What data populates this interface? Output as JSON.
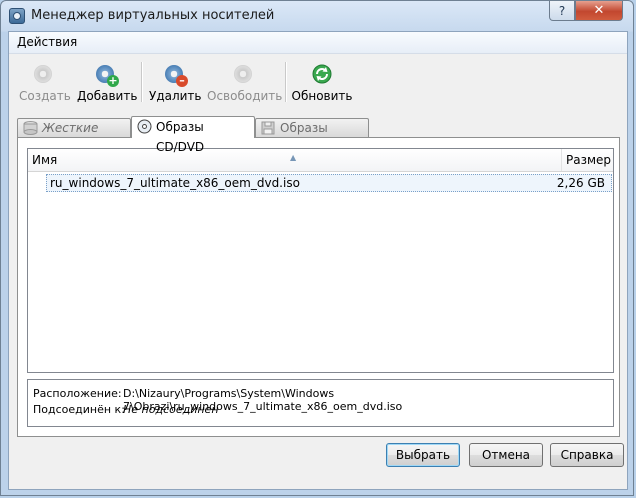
{
  "window": {
    "title": "Менеджер виртуальных носителей",
    "close_glyph": "✕",
    "help_glyph": "?"
  },
  "menu": {
    "actions": "Действия"
  },
  "toolbar": {
    "create": {
      "label": "Создать",
      "icon": "disk-new-icon",
      "enabled": false
    },
    "add": {
      "label": "Добавить",
      "icon": "disk-add-icon",
      "enabled": true
    },
    "remove": {
      "label": "Удалить",
      "icon": "disk-remove-icon",
      "enabled": true
    },
    "release": {
      "label": "Освободить",
      "icon": "disk-release-icon",
      "enabled": false
    },
    "refresh": {
      "label": "Обновить",
      "icon": "refresh-icon",
      "enabled": true
    }
  },
  "tabs": [
    {
      "label": "Жесткие диски",
      "icon": "hard-disk-icon",
      "active": false
    },
    {
      "label": "Образы CD/DVD",
      "icon": "cd-icon",
      "active": true
    },
    {
      "label": "Образы дискет",
      "icon": "floppy-icon",
      "active": false
    }
  ],
  "list": {
    "columns": {
      "name": "Имя",
      "size": "Размер"
    },
    "rows": [
      {
        "name": "ru_windows_7_ultimate_x86_oem_dvd.iso",
        "size": "2,26 GB",
        "selected": true
      }
    ]
  },
  "details": {
    "location_label": "Расположение:",
    "location_value": "D:\\Nizaury\\Programs\\System\\Windows 7\\Obrazi\\ru_windows_7_ultimate_x86_oem_dvd.iso",
    "attached_label": "Подсоединён к:",
    "attached_value": "Не подсоединен"
  },
  "buttons": {
    "select": "Выбрать",
    "cancel": "Отмена",
    "help": "Справка"
  },
  "colors": {
    "titlebar": "#c7d9ee",
    "selection": "#eef5fc",
    "disabled_text": "#8c8c8c"
  }
}
